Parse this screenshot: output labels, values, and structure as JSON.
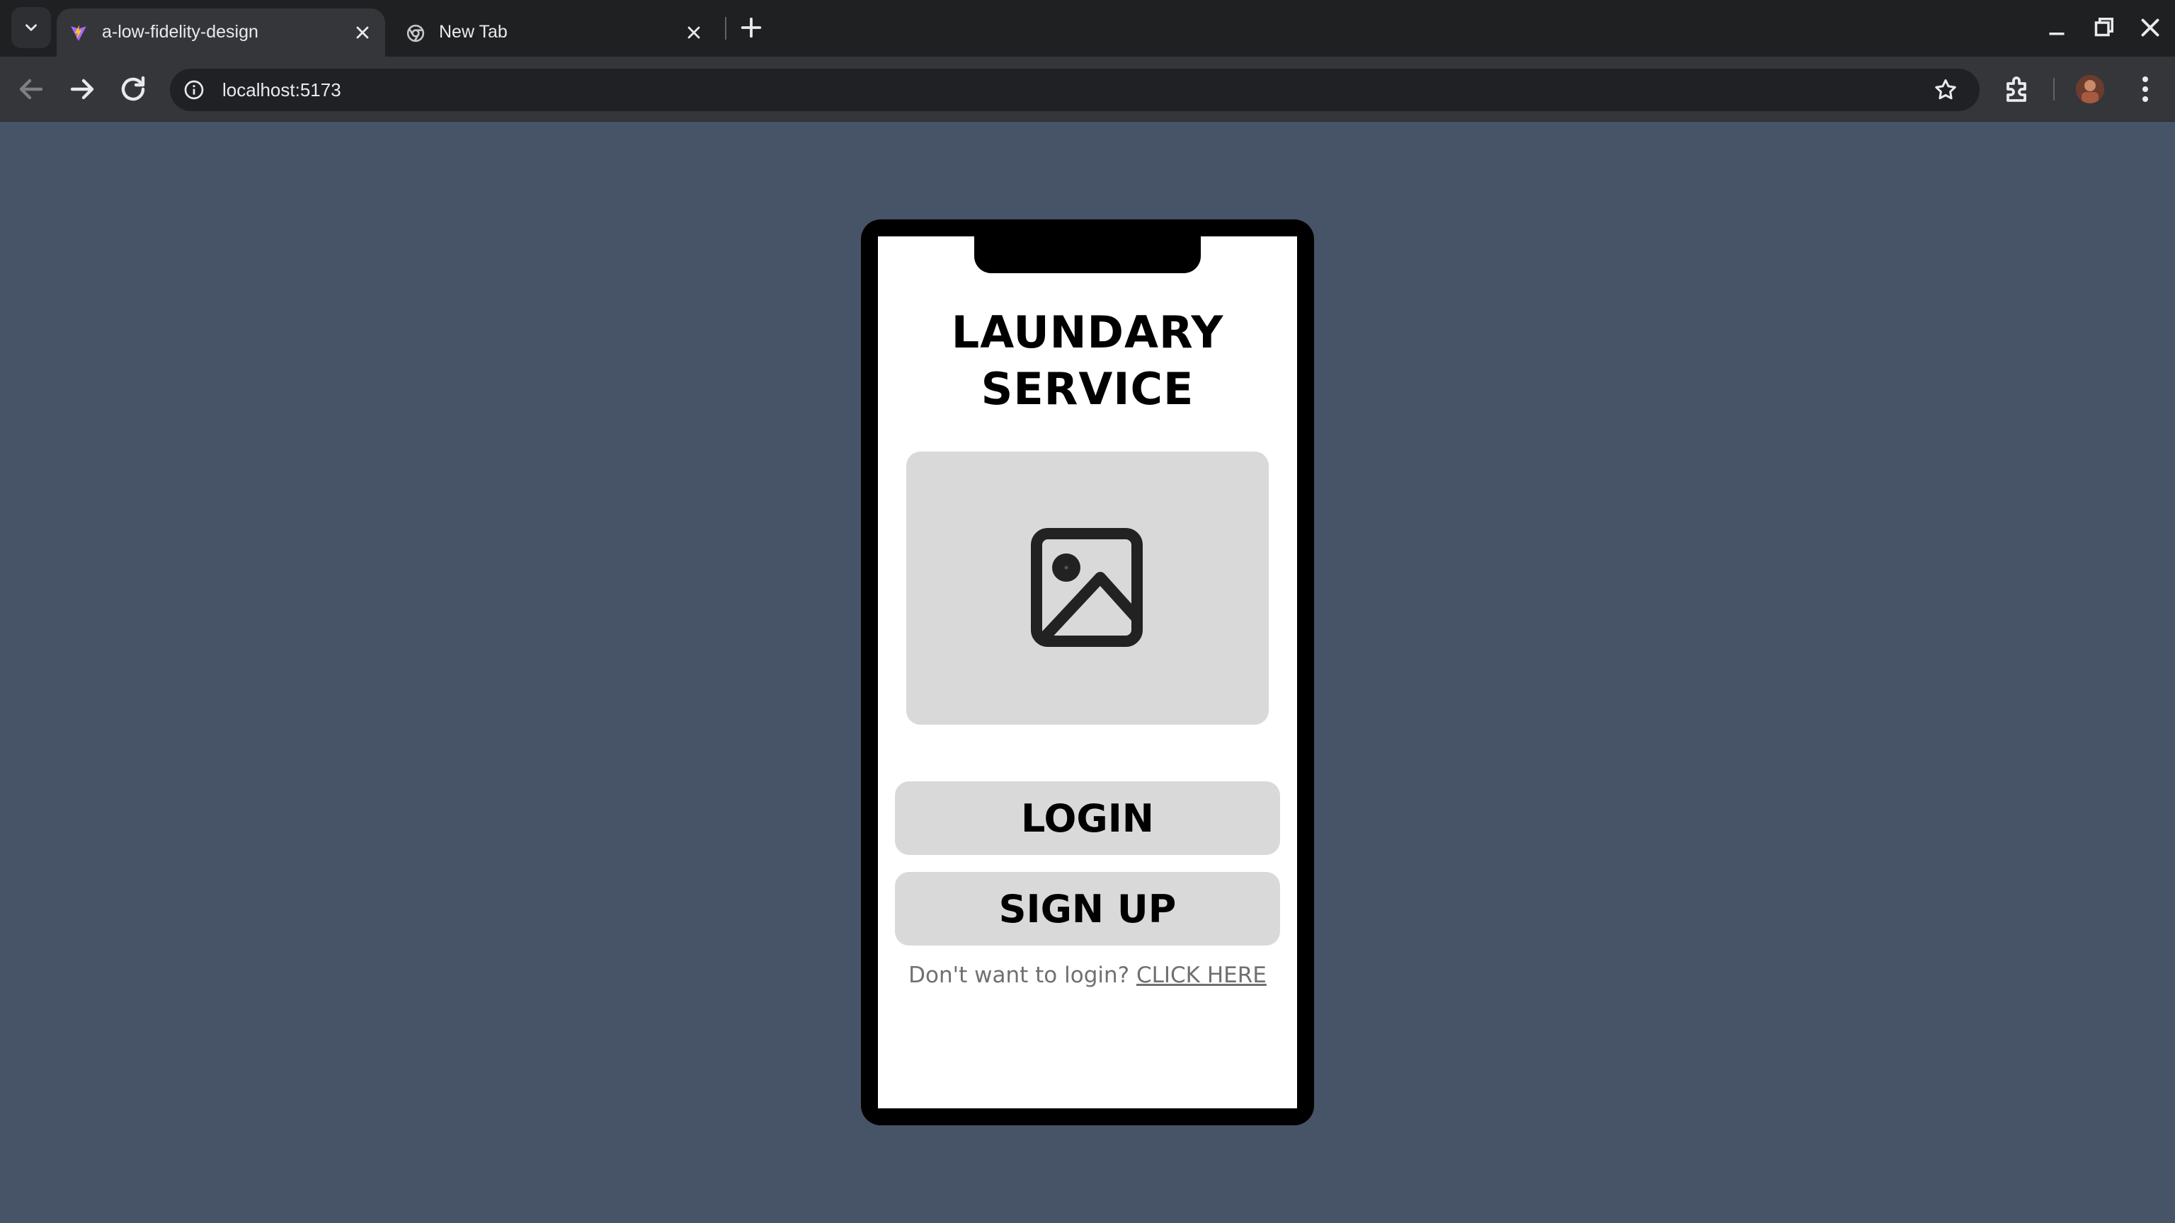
{
  "browser": {
    "tabs": [
      {
        "title": "a-low-fidelity-design",
        "active": true
      },
      {
        "title": "New Tab",
        "active": false
      }
    ],
    "address": "localhost:5173"
  },
  "app": {
    "title_line1": "LAUNDARY",
    "title_line2": "SERVICE",
    "image_placeholder_icon": "image-icon",
    "login_label": "LOGIN",
    "signup_label": "SIGN UP",
    "guest_prompt": "Don't want to login?",
    "guest_link": "CLICK HERE"
  },
  "colors": {
    "page_background": "#475467",
    "phone_frame": "#000000",
    "placeholder_gray": "#d9d9d9",
    "muted_text": "#707070"
  }
}
